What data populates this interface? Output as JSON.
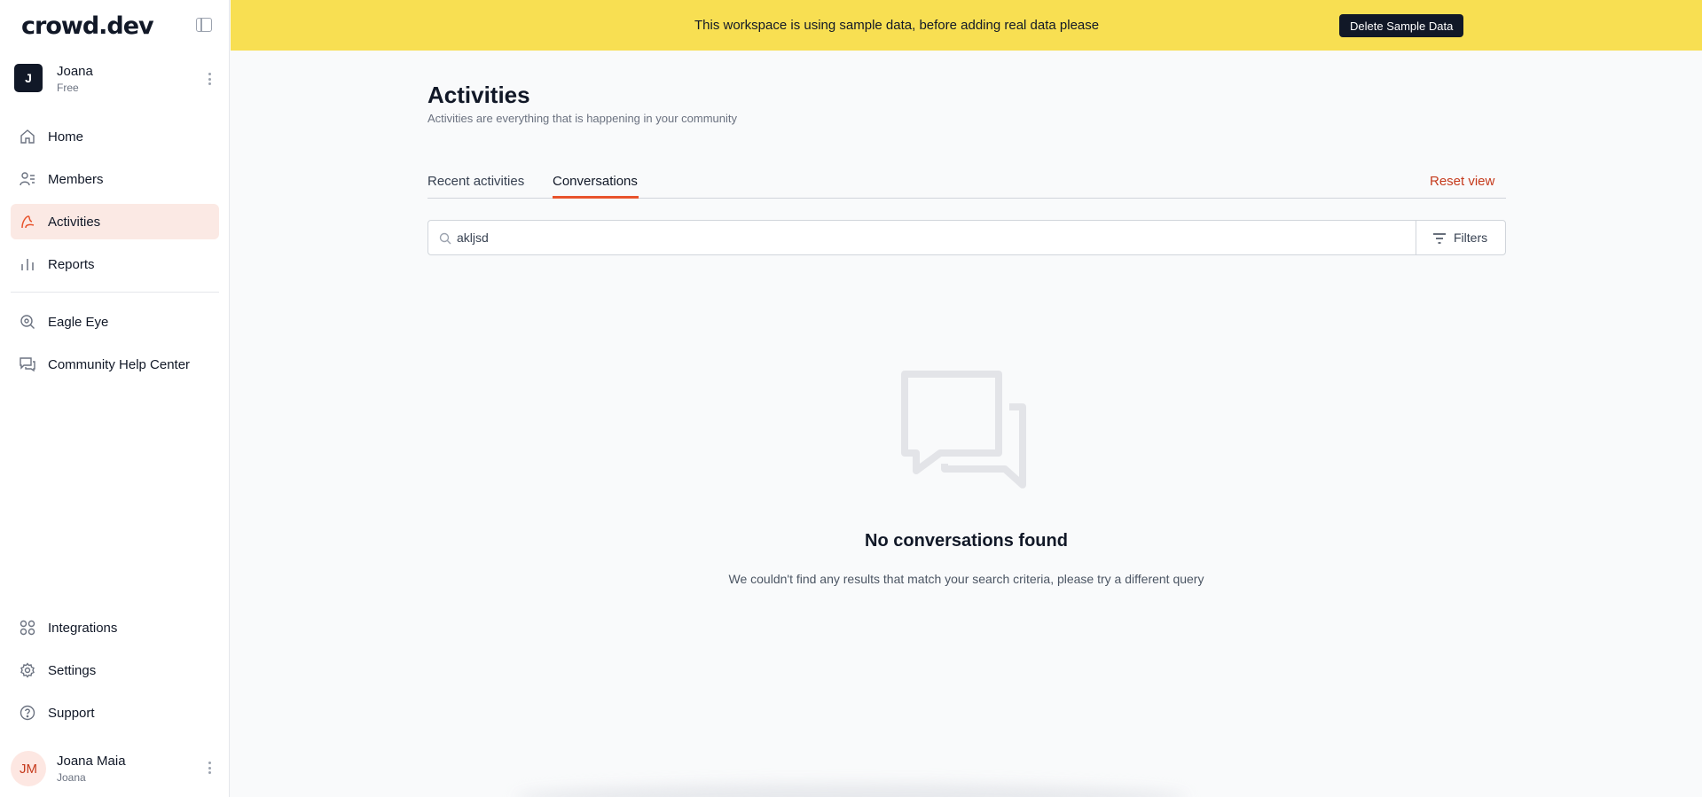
{
  "app": {
    "logo": "crowd.dev"
  },
  "workspace": {
    "initial": "J",
    "name": "Joana",
    "plan": "Free"
  },
  "sidebar": {
    "items": [
      {
        "label": "Home",
        "icon": "home-icon"
      },
      {
        "label": "Members",
        "icon": "members-icon"
      },
      {
        "label": "Activities",
        "icon": "activities-icon",
        "active": true
      },
      {
        "label": "Reports",
        "icon": "reports-icon"
      },
      {
        "label": "Eagle Eye",
        "icon": "eagle-eye-icon"
      },
      {
        "label": "Community Help Center",
        "icon": "help-center-icon"
      }
    ],
    "bottom_items": [
      {
        "label": "Integrations",
        "icon": "integrations-icon"
      },
      {
        "label": "Settings",
        "icon": "settings-icon"
      },
      {
        "label": "Support",
        "icon": "support-icon"
      }
    ]
  },
  "user": {
    "initials": "JM",
    "name": "Joana Maia",
    "handle": "Joana"
  },
  "banner": {
    "text": "This workspace is using sample data, before adding real data please",
    "button_label": "Delete Sample Data"
  },
  "page": {
    "title": "Activities",
    "subtitle": "Activities are everything that is happening in your community"
  },
  "tabs": [
    {
      "label": "Recent activities",
      "active": false
    },
    {
      "label": "Conversations",
      "active": true
    }
  ],
  "reset_view_label": "Reset view",
  "search": {
    "value": "akljsd"
  },
  "filters_label": "Filters",
  "empty_state": {
    "title": "No conversations found",
    "subtitle": "We couldn't find any results that match your search criteria, please try a different query"
  },
  "colors": {
    "accent": "#e8532c",
    "accent_text": "#c53a1c",
    "banner_bg": "#f8df52",
    "active_nav_bg": "#fbe9e4"
  }
}
